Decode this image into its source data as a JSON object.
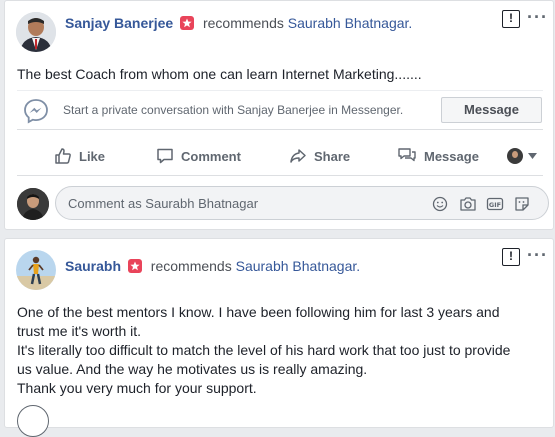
{
  "post1": {
    "author": "Sanjay Banerjee",
    "action": "recommends",
    "target": "Saurabh Bhatnagar.",
    "text": "The best Coach from whom one can learn Internet Marketing.......",
    "messenger_prompt": "Start a private conversation with Sanjay Banerjee in Messenger.",
    "message_button": "Message",
    "actions": {
      "like": "Like",
      "comment": "Comment",
      "share": "Share",
      "message": "Message"
    },
    "comment_placeholder": "Comment as Saurabh Bhatnagar"
  },
  "post2": {
    "author": "Saurabh",
    "action": "recommends",
    "target": "Saurabh Bhatnagar.",
    "line1": "One of the best mentors I know. I have been following him for last 3 years and",
    "line2": "trust me it's worth it.",
    "line3": "It's literally too difficult to match the level of his hard work that too just to provide",
    "line4": "us value. And the way he motivates us is really amazing.",
    "line5": "Thank you very much for your support."
  },
  "colors": {
    "link": "#365899",
    "badge": "#e9445a",
    "messenger": "#7f8fa6"
  },
  "icons": [
    "recommend-star-icon",
    "report-icon",
    "more-options-icon",
    "messenger-icon",
    "like-icon",
    "comment-icon",
    "share-icon",
    "message-icon",
    "emoji-icon",
    "camera-icon",
    "gif-icon",
    "sticker-icon"
  ]
}
